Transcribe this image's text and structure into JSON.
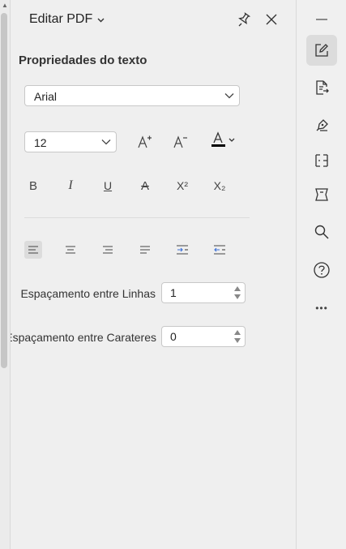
{
  "left_scrollbar": {
    "up_arrow": "▲"
  },
  "panel": {
    "title": "Editar PDF",
    "section_title": "Propriedades do texto",
    "font_family": {
      "value": "Arial"
    },
    "font_size": {
      "value": "12"
    },
    "format_tools": [
      {
        "name": "bold",
        "label": "B"
      },
      {
        "name": "italic",
        "label": "I"
      },
      {
        "name": "underline",
        "label": "U"
      },
      {
        "name": "strikethrough",
        "label": "A"
      },
      {
        "name": "superscript",
        "label": "X²"
      },
      {
        "name": "subscript",
        "label": "X₂"
      }
    ],
    "line_spacing": {
      "label": "Espaçamento entre Linhas",
      "value": "1"
    },
    "char_spacing": {
      "label": "Espaçamento entre Carateres",
      "value": "0"
    }
  },
  "right_bar": {
    "more_label": "•••"
  },
  "colors": {
    "text_color_bar": "#000000",
    "accent_indent": "#3a6fd8"
  }
}
